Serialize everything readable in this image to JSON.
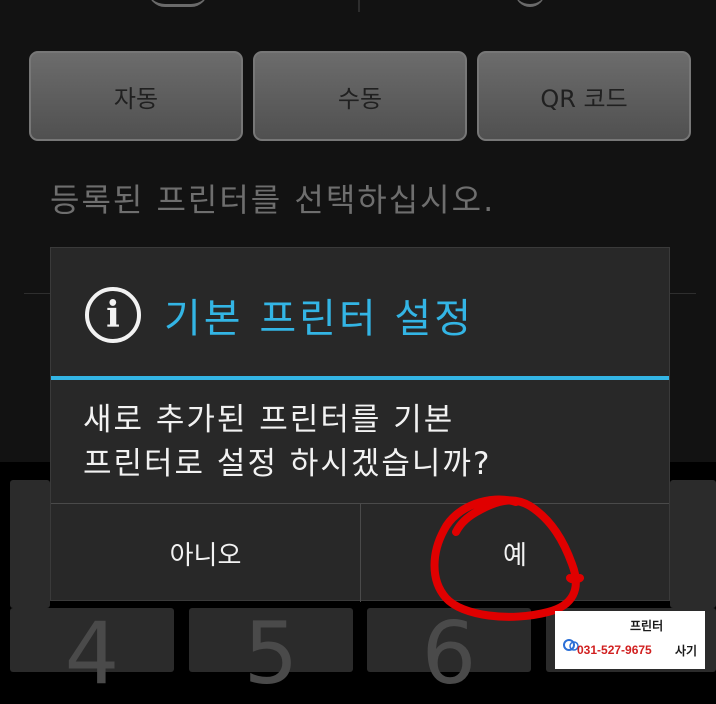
{
  "mode_buttons": {
    "auto": "자동",
    "manual": "수동",
    "qr": "QR 코드"
  },
  "instruction": "등록된 프린터를 선택하십시오.",
  "dialog": {
    "title": "기본 프린터 설정",
    "message_line1": "새로 추가된 프린터를 기본",
    "message_line2": "프린터로 설정 하시겠습니까?",
    "no_label": "아니오",
    "yes_label": "예",
    "accent_color": "#33b5e5"
  },
  "keypad": {
    "keys": [
      "4",
      "5",
      "6"
    ]
  },
  "watermark": {
    "brand": "프린터",
    "phone": "031-527-9675",
    "suffix": "사기"
  },
  "annotation_color": "#e00000"
}
